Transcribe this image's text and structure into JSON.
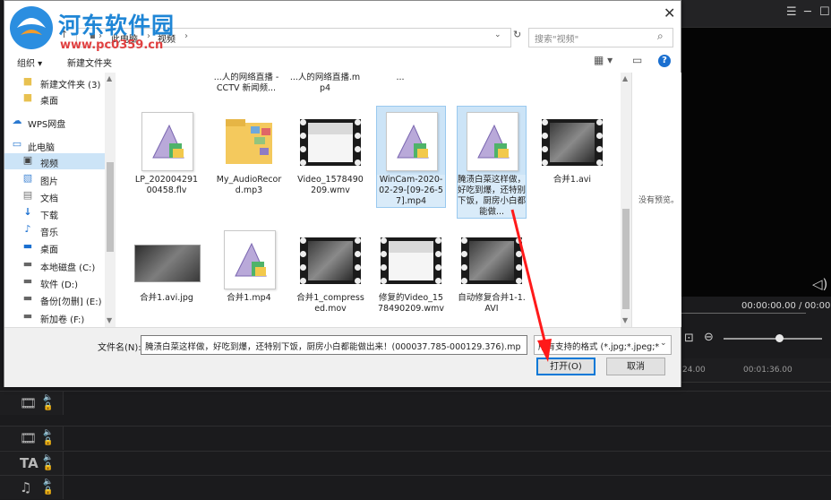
{
  "app": {
    "timecode": "00:00:00.00 / 00:00",
    "ruler_left": "24.00",
    "ruler_right": "00:01:36.00"
  },
  "watermark": {
    "title": "河东软件园",
    "url": "www.pc0359.cn"
  },
  "dialog": {
    "title": "打开",
    "breadcrumbs": [
      "此电脑",
      "视频"
    ],
    "search_placeholder": "搜索\"视频\"",
    "toolbar": {
      "organize": "组织 ▾",
      "new_folder": "新建文件夹"
    },
    "nav_items": [
      {
        "label": "新建文件夹 (3)",
        "icon": "folder-icon"
      },
      {
        "label": "桌面",
        "icon": "folder-icon"
      },
      {
        "label": "WPS网盘",
        "icon": "cloud-icon"
      },
      {
        "label": "此电脑",
        "icon": "computer-icon"
      },
      {
        "label": "视频",
        "icon": "video-folder-icon",
        "selected": true
      },
      {
        "label": "图片",
        "icon": "pictures-icon"
      },
      {
        "label": "文档",
        "icon": "documents-icon"
      },
      {
        "label": "下载",
        "icon": "download-icon"
      },
      {
        "label": "音乐",
        "icon": "music-icon"
      },
      {
        "label": "桌面",
        "icon": "desktop-icon"
      },
      {
        "label": "本地磁盘 (C:)",
        "icon": "drive-icon"
      },
      {
        "label": "软件 (D:)",
        "icon": "drive-icon"
      },
      {
        "label": "备份[勿删] (E:)",
        "icon": "drive-icon"
      },
      {
        "label": "新加卷 (F:)",
        "icon": "drive-icon"
      }
    ],
    "partial_row": [
      "...人的网络直播 - CCTV 新闻频...",
      "...人的网络直播.mp4",
      "..."
    ],
    "files_row1": [
      {
        "name": "LP_20200429100458.flv",
        "kind": "doc"
      },
      {
        "name": "My_AudioRecord.mp3",
        "kind": "folder"
      },
      {
        "name": "Video_1578490209.wmv",
        "kind": "video"
      },
      {
        "name": "WinCam-2020-02-29-[09-26-57].mp4",
        "kind": "doc",
        "selected": true
      },
      {
        "name": "腌渍白菜这样做，好吃到爆，还特别下饭，厨房小白都能做...",
        "kind": "doc",
        "selected": true
      },
      {
        "name": "合并1.avi",
        "kind": "video"
      }
    ],
    "files_row2": [
      {
        "name": "合并1.avi.jpg",
        "kind": "image"
      },
      {
        "name": "合并1.mp4",
        "kind": "doc"
      },
      {
        "name": "合并1_compressed.mov",
        "kind": "video"
      },
      {
        "name": "修复的Video_1578490209.wmv",
        "kind": "video"
      },
      {
        "name": "自动修复合并1-1.AVI",
        "kind": "video"
      }
    ],
    "no_preview": "没有预览。",
    "filename_label": "文件名(N):",
    "filename_value": "腌渍白菜这样做，好吃到爆，还特别下饭，厨房小白都能做出来！(000037.785-000129.376).mp",
    "filetype_value": "所有支持的格式 (*.jpg;*.jpeg;*",
    "open_button": "打开(O)",
    "cancel_button": "取消"
  },
  "colors": {
    "accent": "#0078d7",
    "selection": "#cce4f7",
    "arrow": "#ff1a1a",
    "watermark_blue": "#1f86d6",
    "watermark_red": "#e04040"
  }
}
